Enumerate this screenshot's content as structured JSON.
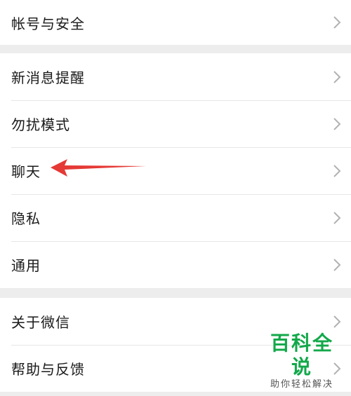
{
  "settings": {
    "groups": [
      {
        "items": [
          {
            "label": "帐号与安全",
            "icon": "chevron-right-icon"
          }
        ]
      },
      {
        "items": [
          {
            "label": "新消息提醒",
            "icon": "chevron-right-icon"
          },
          {
            "label": "勿扰模式",
            "icon": "chevron-right-icon"
          },
          {
            "label": "聊天",
            "icon": "chevron-right-icon"
          },
          {
            "label": "隐私",
            "icon": "chevron-right-icon"
          },
          {
            "label": "通用",
            "icon": "chevron-right-icon"
          }
        ]
      },
      {
        "items": [
          {
            "label": "关于微信",
            "icon": "chevron-right-icon"
          },
          {
            "label": "帮助与反馈",
            "icon": "chevron-right-icon"
          }
        ]
      }
    ]
  },
  "annotation": {
    "icon": "red-arrow-icon",
    "color": "#e53935",
    "points_to": "聊天"
  },
  "watermark": {
    "title": "百科全说",
    "subtitle": "助你轻松解决"
  }
}
